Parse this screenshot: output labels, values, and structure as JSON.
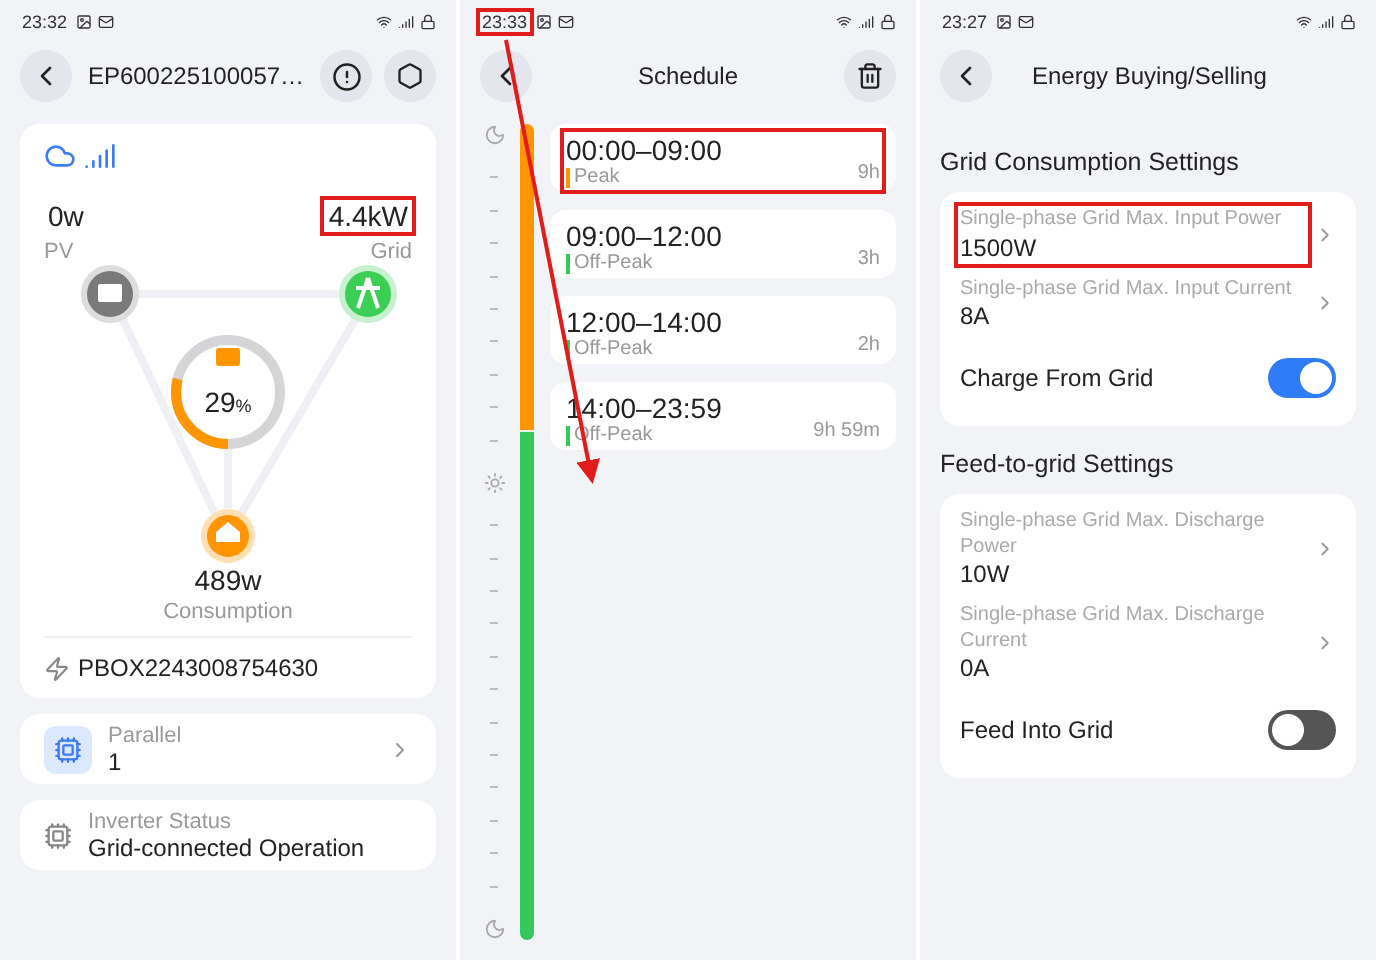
{
  "device_screen": {
    "status_bar": {
      "time": "23:32"
    },
    "title": "EP600225100057…",
    "power_flow": {
      "pv": {
        "value": "0w",
        "label": "PV"
      },
      "grid": {
        "value": "4.4kW",
        "label": "Grid",
        "highlighted": true
      },
      "battery": {
        "reading": "29",
        "unit": "%",
        "level": 0.29
      },
      "consumption": {
        "value": "489w",
        "label": "Consumption"
      }
    },
    "device_id": "PBOX2243008754630",
    "cards": [
      {
        "kind": "link",
        "label": "Parallel",
        "value": "1"
      },
      {
        "kind": "status",
        "label": "Inverter Status",
        "value": "Grid-connected Operation"
      }
    ]
  },
  "schedule_screen": {
    "status_bar": {
      "time": "23:33",
      "highlighted": true
    },
    "title": "Schedule",
    "items": [
      {
        "time": "00:00–09:00",
        "tariff": "Peak",
        "duration": "9h",
        "color": "#ff9500",
        "highlighted": true
      },
      {
        "time": "09:00–12:00",
        "tariff": "Off-Peak",
        "duration": "3h",
        "color": "#34c759"
      },
      {
        "time": "12:00–14:00",
        "tariff": "Off-Peak",
        "duration": "2h",
        "color": "#34c759"
      },
      {
        "time": "14:00–23:59",
        "tariff": "Off-Peak",
        "duration": "9h 59m",
        "color": "#34c759"
      }
    ]
  },
  "energy_screen": {
    "status_bar": {
      "time": "23:27"
    },
    "title": "Energy Buying/Selling",
    "sections": [
      {
        "title": "Grid Consumption Settings",
        "rows": [
          {
            "kind": "value",
            "label": "Single-phase Grid Max. Input Power",
            "value": "1500W",
            "highlighted": true
          },
          {
            "kind": "value",
            "label": "Single-phase Grid Max. Input Current",
            "value": "8A"
          },
          {
            "kind": "toggle",
            "label": "Charge From Grid",
            "on": true
          }
        ]
      },
      {
        "title": "Feed-to-grid Settings",
        "rows": [
          {
            "kind": "value",
            "label": "Single-phase Grid Max. Discharge Power",
            "value": "10W"
          },
          {
            "kind": "value",
            "label": "Single-phase Grid Max. Discharge Current",
            "value": "0A"
          },
          {
            "kind": "toggle",
            "label": "Feed Into Grid",
            "on": false
          }
        ]
      }
    ]
  }
}
